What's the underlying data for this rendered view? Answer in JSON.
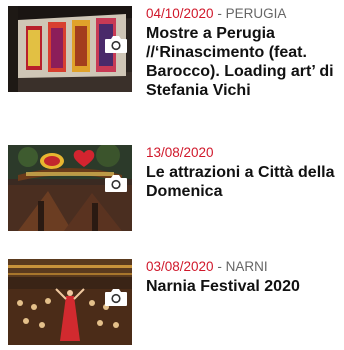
{
  "articles": [
    {
      "date": "04/10/2020",
      "location": " - PERUGIA",
      "title": "Mostre a Perugia //‘Rinascimento (feat. Barocco). Loading art’ di Stefania Vichi",
      "thumb_icon": "camera-icon"
    },
    {
      "date": "13/08/2020",
      "location": "",
      "title": "Le attrazioni a Città della Domenica",
      "thumb_icon": "camera-icon"
    },
    {
      "date": "03/08/2020",
      "location": " - NARNI",
      "title": "Narnia Festival 2020",
      "thumb_icon": "camera-icon"
    }
  ],
  "colors": {
    "date": "#d0182b",
    "location": "#666666",
    "title": "#111111"
  }
}
